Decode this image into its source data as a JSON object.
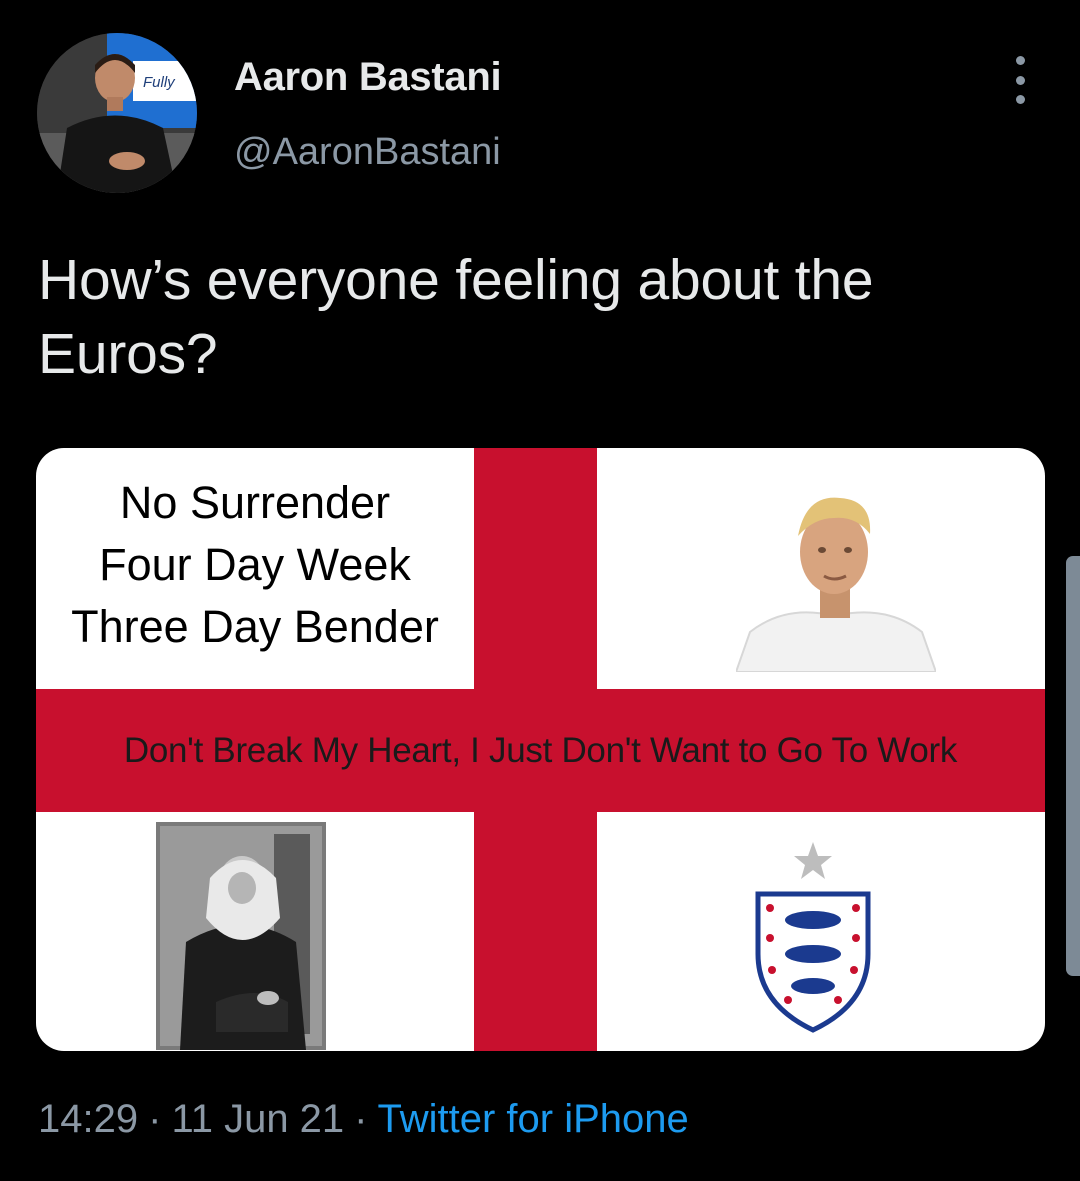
{
  "author": {
    "display_name": "Aaron Bastani",
    "handle": "@AaronBastani",
    "avatar_sign_text": "Fully"
  },
  "tweet": {
    "text": "How’s everyone feeling about the Euros?"
  },
  "media": {
    "quote_lines": [
      "No Surrender",
      "Four Day Week",
      "Three Day Bender"
    ],
    "banner": "Don't Break My Heart, I Just Don't Want to Go To Work",
    "colors": {
      "flag_red": "#c8102e",
      "flag_white": "#ffffff",
      "crest_blue": "#1b3a8f"
    }
  },
  "meta": {
    "time": "14:29",
    "date": "11 Jun 21",
    "separator": "·",
    "source": "Twitter for iPhone"
  },
  "icons": {
    "more": "more-vertical-icon",
    "crest_star": "star-icon"
  },
  "colors": {
    "background": "#000000",
    "primary_text": "#e7e9ea",
    "secondary_text": "#8b98a5",
    "link": "#1d9bf0"
  }
}
